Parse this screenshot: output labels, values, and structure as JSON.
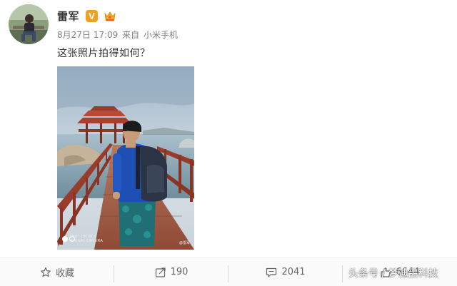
{
  "user": {
    "name": "雷军",
    "verified_badge": "V",
    "verified_color": "#f0a020",
    "extra_badge_icon": "crown-icon"
  },
  "meta": {
    "timestamp": "8月27日 17:09",
    "source_prefix": "来自",
    "source_device": "小米手机"
  },
  "post": {
    "text": "这张照片拍得如何？"
  },
  "photo": {
    "watermark_line1": "SHOT ON MI 6",
    "watermark_line2": "MI DUAL CAMERA",
    "credit": "@雷军"
  },
  "actions": [
    {
      "icon": "star-icon",
      "label": "收藏"
    },
    {
      "icon": "share-icon",
      "label": "190"
    },
    {
      "icon": "comment-icon",
      "label": "2041"
    },
    {
      "icon": "like-icon",
      "label": "6644"
    }
  ],
  "overlay": {
    "source_badge": "头条号 / 梦迪品科技"
  },
  "colors": {
    "text_primary": "#333333",
    "text_meta": "#808080",
    "action_bar_bg": "#fafafa"
  }
}
